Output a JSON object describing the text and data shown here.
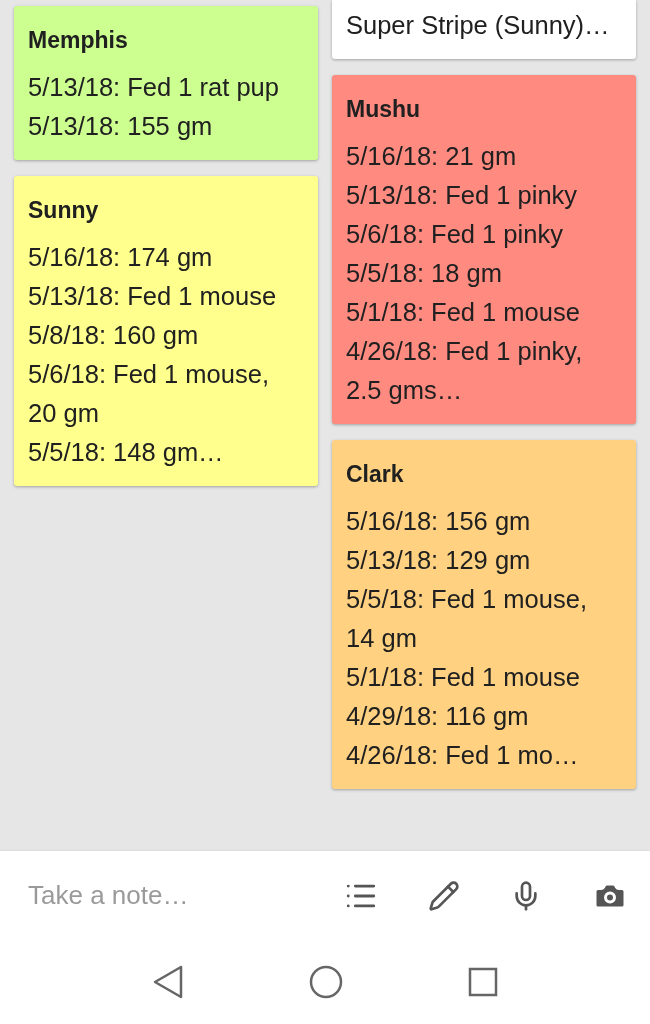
{
  "columns": [
    [
      {
        "title": "Memphis",
        "color": "#ccff90",
        "lines": [
          "5/13/18: Fed 1 rat pup",
          "5/13/18: 155 gm"
        ]
      },
      {
        "title": "Sunny",
        "color": "#ffff8d",
        "lines": [
          "5/16/18: 174 gm",
          "5/13/18: Fed 1 mouse",
          "5/8/18: 160 gm",
          "5/6/18: Fed 1 mouse, 20 gm",
          "5/5/18: 148 gm…"
        ]
      }
    ],
    [
      {
        "color": "#ffffff",
        "lines": [
          "Super Stripe (Sunny)…"
        ]
      },
      {
        "title": "Mushu",
        "color": "#ff8a80",
        "lines": [
          "5/16/18: 21 gm",
          "5/13/18: Fed 1 pinky",
          "5/6/18: Fed 1 pinky",
          "5/5/18: 18 gm",
          "5/1/18: Fed 1 mouse",
          "4/26/18: Fed 1 pinky, 2.5 gms…"
        ]
      },
      {
        "title": "Clark",
        "color": "#ffd180",
        "lines": [
          "5/16/18: 156 gm",
          "5/13/18: 129 gm",
          "5/5/18: Fed 1 mouse, 14 gm",
          "5/1/18: Fed 1 mouse",
          "4/29/18: 116 gm",
          "4/26/18: Fed 1 mo…"
        ]
      }
    ]
  ],
  "note_bar": {
    "placeholder": "Take a note…"
  }
}
